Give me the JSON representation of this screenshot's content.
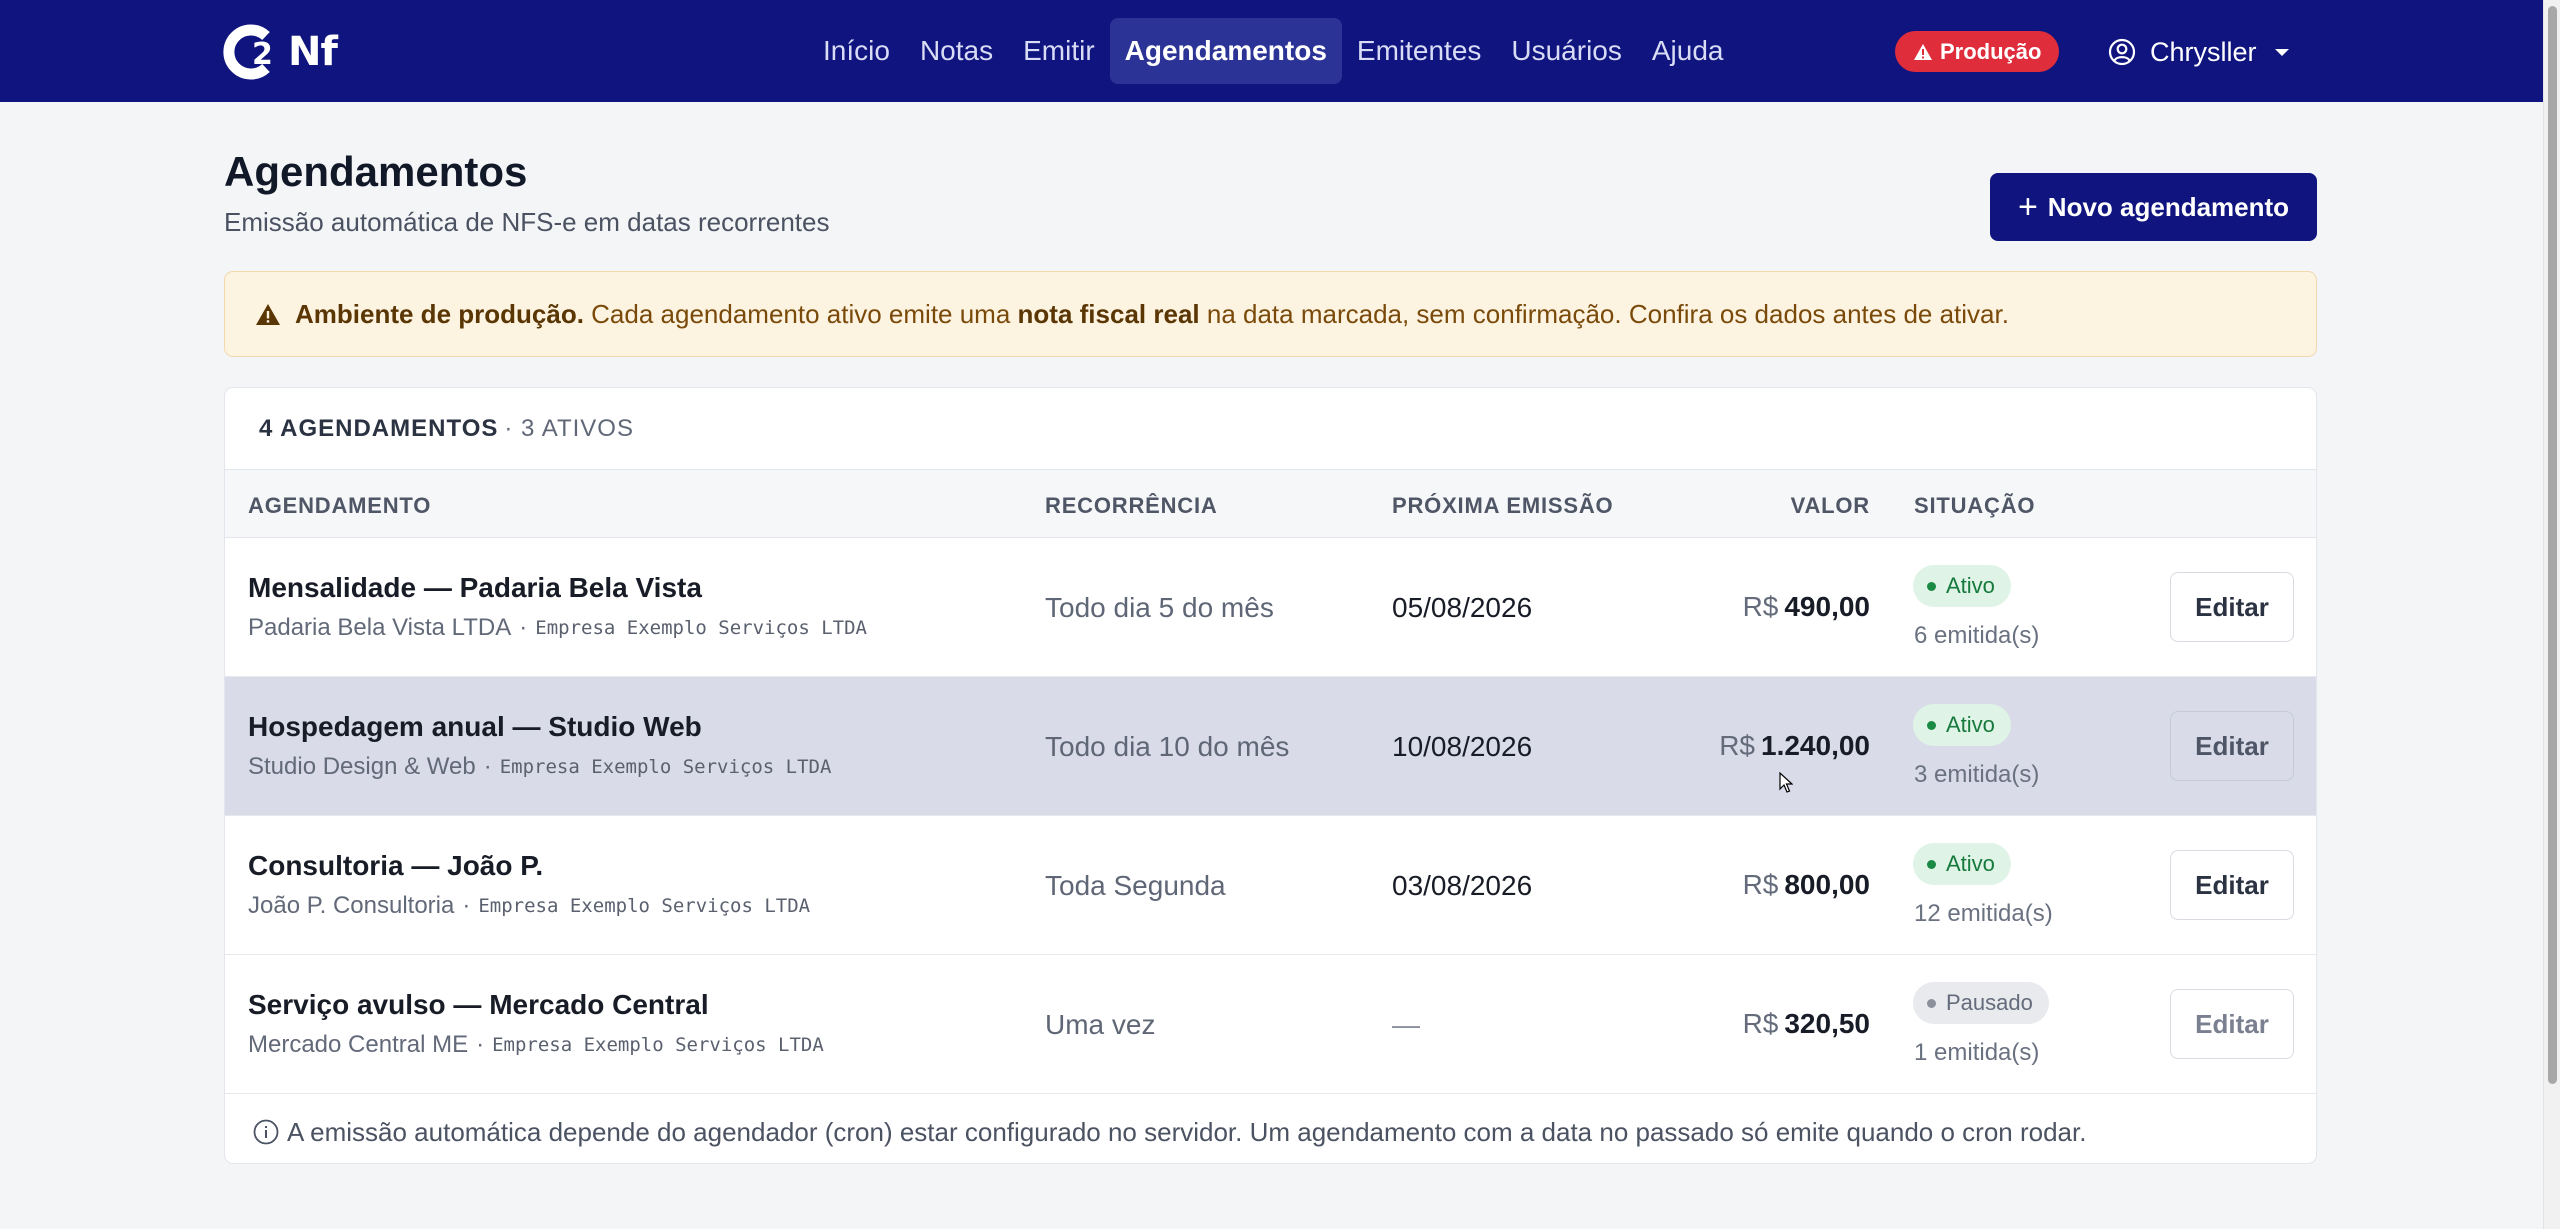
{
  "brand": {
    "logo_text": "Nf"
  },
  "nav": {
    "items": [
      {
        "label": "Início"
      },
      {
        "label": "Notas"
      },
      {
        "label": "Emitir"
      },
      {
        "label": "Agendamentos"
      },
      {
        "label": "Emitentes"
      },
      {
        "label": "Usuários"
      },
      {
        "label": "Ajuda"
      }
    ],
    "active_index": 3,
    "environment_badge": "Produção",
    "user_name": "Chrysller"
  },
  "header": {
    "title": "Agendamentos",
    "subtitle": "Emissão automática de NFS-e em datas recorrentes",
    "new_button_label": "Novo agendamento"
  },
  "alert": {
    "strong_label": "Ambiente de produção.",
    "text_before": "Cada agendamento ativo emite uma",
    "strong_mid": "nota fiscal real",
    "text_after": "na data marcada, sem confirmação. Confira os dados antes de ativar."
  },
  "table": {
    "summary_count": "4 AGENDAMENTOS",
    "summary_active": "· 3 ATIVOS",
    "columns": {
      "schedule": "AGENDAMENTO",
      "recurrence": "RECORRÊNCIA",
      "next_issue": "PRÓXIMA EMISSÃO",
      "value": "VALOR",
      "status": "SITUAÇÃO"
    },
    "currency": "R$",
    "edit_label": "Editar",
    "rows": [
      {
        "title": "Mensalidade — Padaria Bela Vista",
        "client": "Padaria Bela Vista LTDA",
        "issuer": "Empresa Exemplo Serviços LTDA",
        "recurrence": "Todo dia 5 do mês",
        "next_issue": "05/08/2026",
        "value": "490,00",
        "status": "Ativo",
        "issued_count": "6 emitida(s)"
      },
      {
        "title": "Hospedagem anual — Studio Web",
        "client": "Studio Design & Web",
        "issuer": "Empresa Exemplo Serviços LTDA",
        "recurrence": "Todo dia 10 do mês",
        "next_issue": "10/08/2026",
        "value": "1.240,00",
        "status": "Ativo",
        "issued_count": "3 emitida(s)"
      },
      {
        "title": "Consultoria — João P.",
        "client": "João P. Consultoria",
        "issuer": "Empresa Exemplo Serviços LTDA",
        "recurrence": "Toda Segunda",
        "next_issue": "03/08/2026",
        "value": "800,00",
        "status": "Ativo",
        "issued_count": "12 emitida(s)"
      },
      {
        "title": "Serviço avulso — Mercado Central",
        "client": "Mercado Central ME",
        "issuer": "Empresa Exemplo Serviços LTDA",
        "recurrence": "Uma vez",
        "next_issue": "—",
        "value": "320,50",
        "status": "Pausado",
        "issued_count": "1 emitida(s)"
      }
    ],
    "footnote": "A emissão automática depende do agendador (cron) estar configurado no servidor. Um agendamento com a data no passado só emite quando o cron rodar."
  },
  "colors": {
    "navbar": "#0f147f",
    "primary": "#0f147f",
    "danger_badge": "#e02d3c",
    "active_status": "#177a3d",
    "warning_bg": "#fdf3e1"
  }
}
